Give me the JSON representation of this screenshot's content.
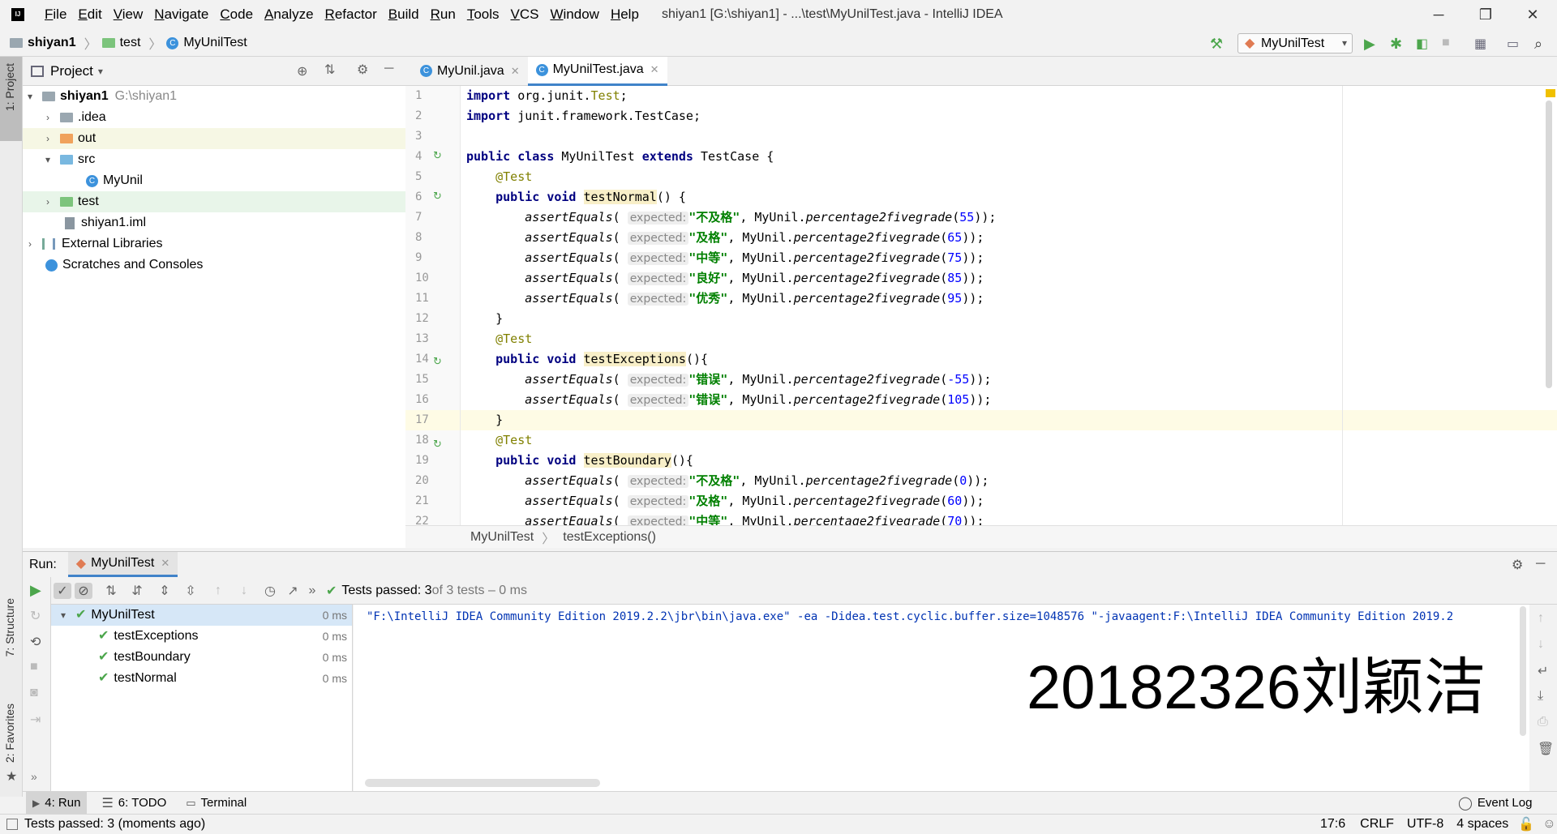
{
  "window": {
    "title": "shiyan1 [G:\\shiyan1] - ...\\test\\MyUnilTest.java - IntelliJ IDEA"
  },
  "menu": [
    "File",
    "Edit",
    "View",
    "Navigate",
    "Code",
    "Analyze",
    "Refactor",
    "Build",
    "Run",
    "Tools",
    "VCS",
    "Window",
    "Help"
  ],
  "breadcrumb": {
    "project": "shiyan1",
    "folder": "test",
    "file": "MyUnilTest"
  },
  "run_config": "MyUnilTest",
  "left_stripe": {
    "project": "1: Project",
    "structure": "7: Structure",
    "favorites": "2: Favorites"
  },
  "project_panel": {
    "title": "Project"
  },
  "tree": [
    {
      "label": "shiyan1",
      "path": "G:\\shiyan1"
    },
    {
      "label": ".idea"
    },
    {
      "label": "out"
    },
    {
      "label": "src"
    },
    {
      "label": "MyUnil"
    },
    {
      "label": "test"
    },
    {
      "label": "shiyan1.iml"
    },
    {
      "label": "External Libraries"
    },
    {
      "label": "Scratches and Consoles"
    }
  ],
  "tabs": [
    {
      "label": "MyUnil.java"
    },
    {
      "label": "MyUnilTest.java"
    }
  ],
  "code": {
    "line_numbers": [
      "1",
      "2",
      "3",
      "4",
      "5",
      "6",
      "7",
      "8",
      "9",
      "10",
      "11",
      "12",
      "13",
      "14",
      "15",
      "16",
      "17",
      "18",
      "19",
      "20",
      "21",
      "22"
    ],
    "hint": "expected:",
    "import1_kw": "import",
    "import1_rest": " org.junit.",
    "import1_cls": "Test",
    ";": ";",
    "import2_rest": " junit.framework.TestCase;",
    "class_kw1": "public class",
    "class_name": " MyUnilTest ",
    "class_kw2": "extends",
    "class_rest": " TestCase {",
    "annotation": "@Test",
    "method_kw": "public void",
    "m1": "testNormal",
    "m1_rest": "() {",
    "m2": "testExceptions",
    "m2_rest": "(){",
    "m3": "testBoundary",
    "m3_rest": "(){",
    "assert": "assertEquals",
    "call": "MyUnil.",
    "fn": "percentage2fivegrade",
    "s_bjg": "\"不及格\"",
    "s_jg": "\"及格\"",
    "s_zd": "\"中等\"",
    "s_lh": "\"良好\"",
    "s_yx": "\"优秀\"",
    "s_cw": "\"错误\"",
    "n55": "55",
    "n65": "65",
    "n75": "75",
    "n85": "85",
    "n95": "95",
    "nm55": "-55",
    "n105": "105",
    "n0": "0",
    "n60": "60",
    "n70": "70",
    "close": "}"
  },
  "editor_breadcrumb": {
    "cls": "MyUnilTest",
    "method": "testExceptions()"
  },
  "run": {
    "label": "Run:",
    "tab": "MyUnilTest",
    "status_bold": "Tests passed: 3",
    "status_rest": " of 3 tests – 0 ms",
    "tests": [
      {
        "name": "MyUnilTest",
        "time": "0 ms"
      },
      {
        "name": "testExceptions",
        "time": "0 ms"
      },
      {
        "name": "testBoundary",
        "time": "0 ms"
      },
      {
        "name": "testNormal",
        "time": "0 ms"
      }
    ],
    "console_line": "\"F:\\IntelliJ IDEA Community Edition 2019.2.2\\jbr\\bin\\java.exe\" -ea -Didea.test.cyclic.buffer.size=1048576 \"-javaagent:F:\\IntelliJ IDEA Community Edition 2019.2",
    "overlay": "20182326刘颖洁"
  },
  "bottom_tabs": {
    "run": "4: Run",
    "todo": "6: TODO",
    "terminal": "Terminal",
    "eventlog": "Event Log"
  },
  "status": {
    "message": "Tests passed: 3 (moments ago)",
    "pos": "17:6",
    "eol": "CRLF",
    "enc": "UTF-8",
    "indent": "4 spaces"
  }
}
